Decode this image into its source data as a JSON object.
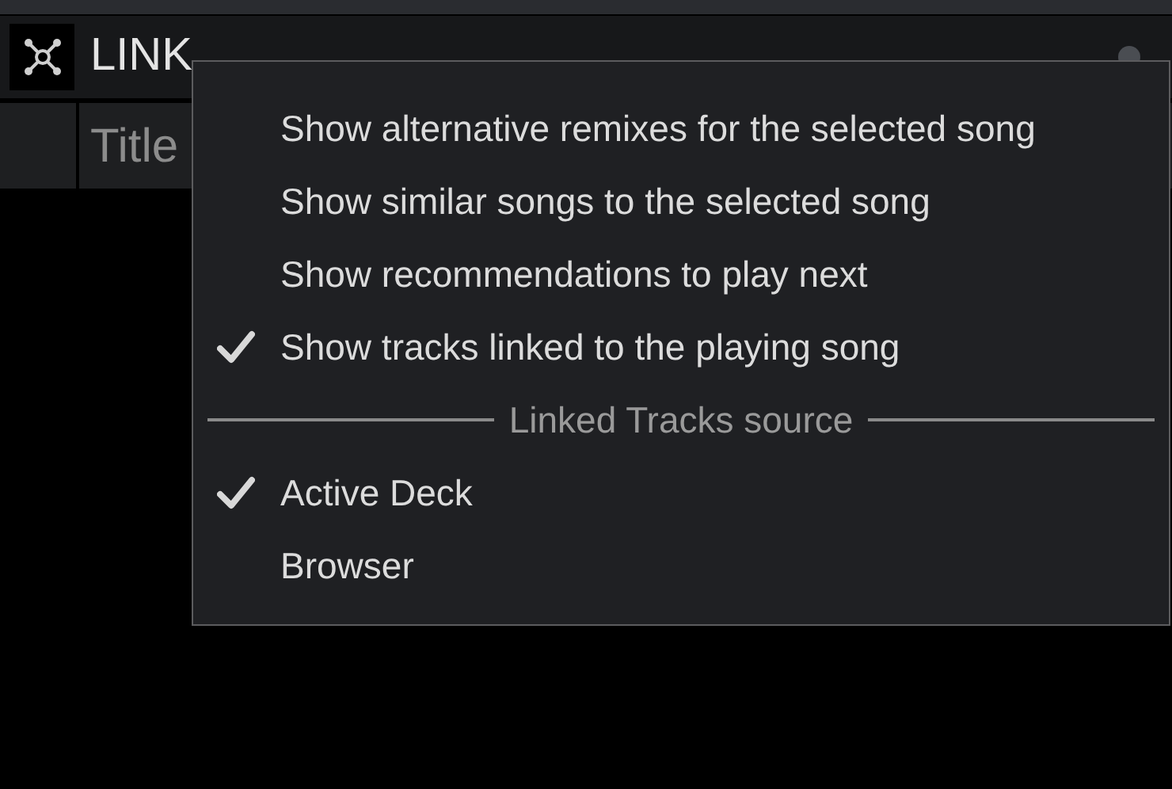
{
  "panel": {
    "title": "LINK",
    "columns": [
      "Title"
    ]
  },
  "context_menu": {
    "items": [
      {
        "kind": "option",
        "label": "Show alternative remixes for the selected song",
        "checked": false
      },
      {
        "kind": "option",
        "label": "Show similar songs to the selected song",
        "checked": false
      },
      {
        "kind": "option",
        "label": "Show recommendations to play next",
        "checked": false
      },
      {
        "kind": "option",
        "label": "Show tracks linked to the playing song",
        "checked": true
      },
      {
        "kind": "section",
        "label": "Linked Tracks source"
      },
      {
        "kind": "option",
        "label": "Active Deck",
        "checked": true
      },
      {
        "kind": "option",
        "label": "Browser",
        "checked": false
      }
    ]
  }
}
